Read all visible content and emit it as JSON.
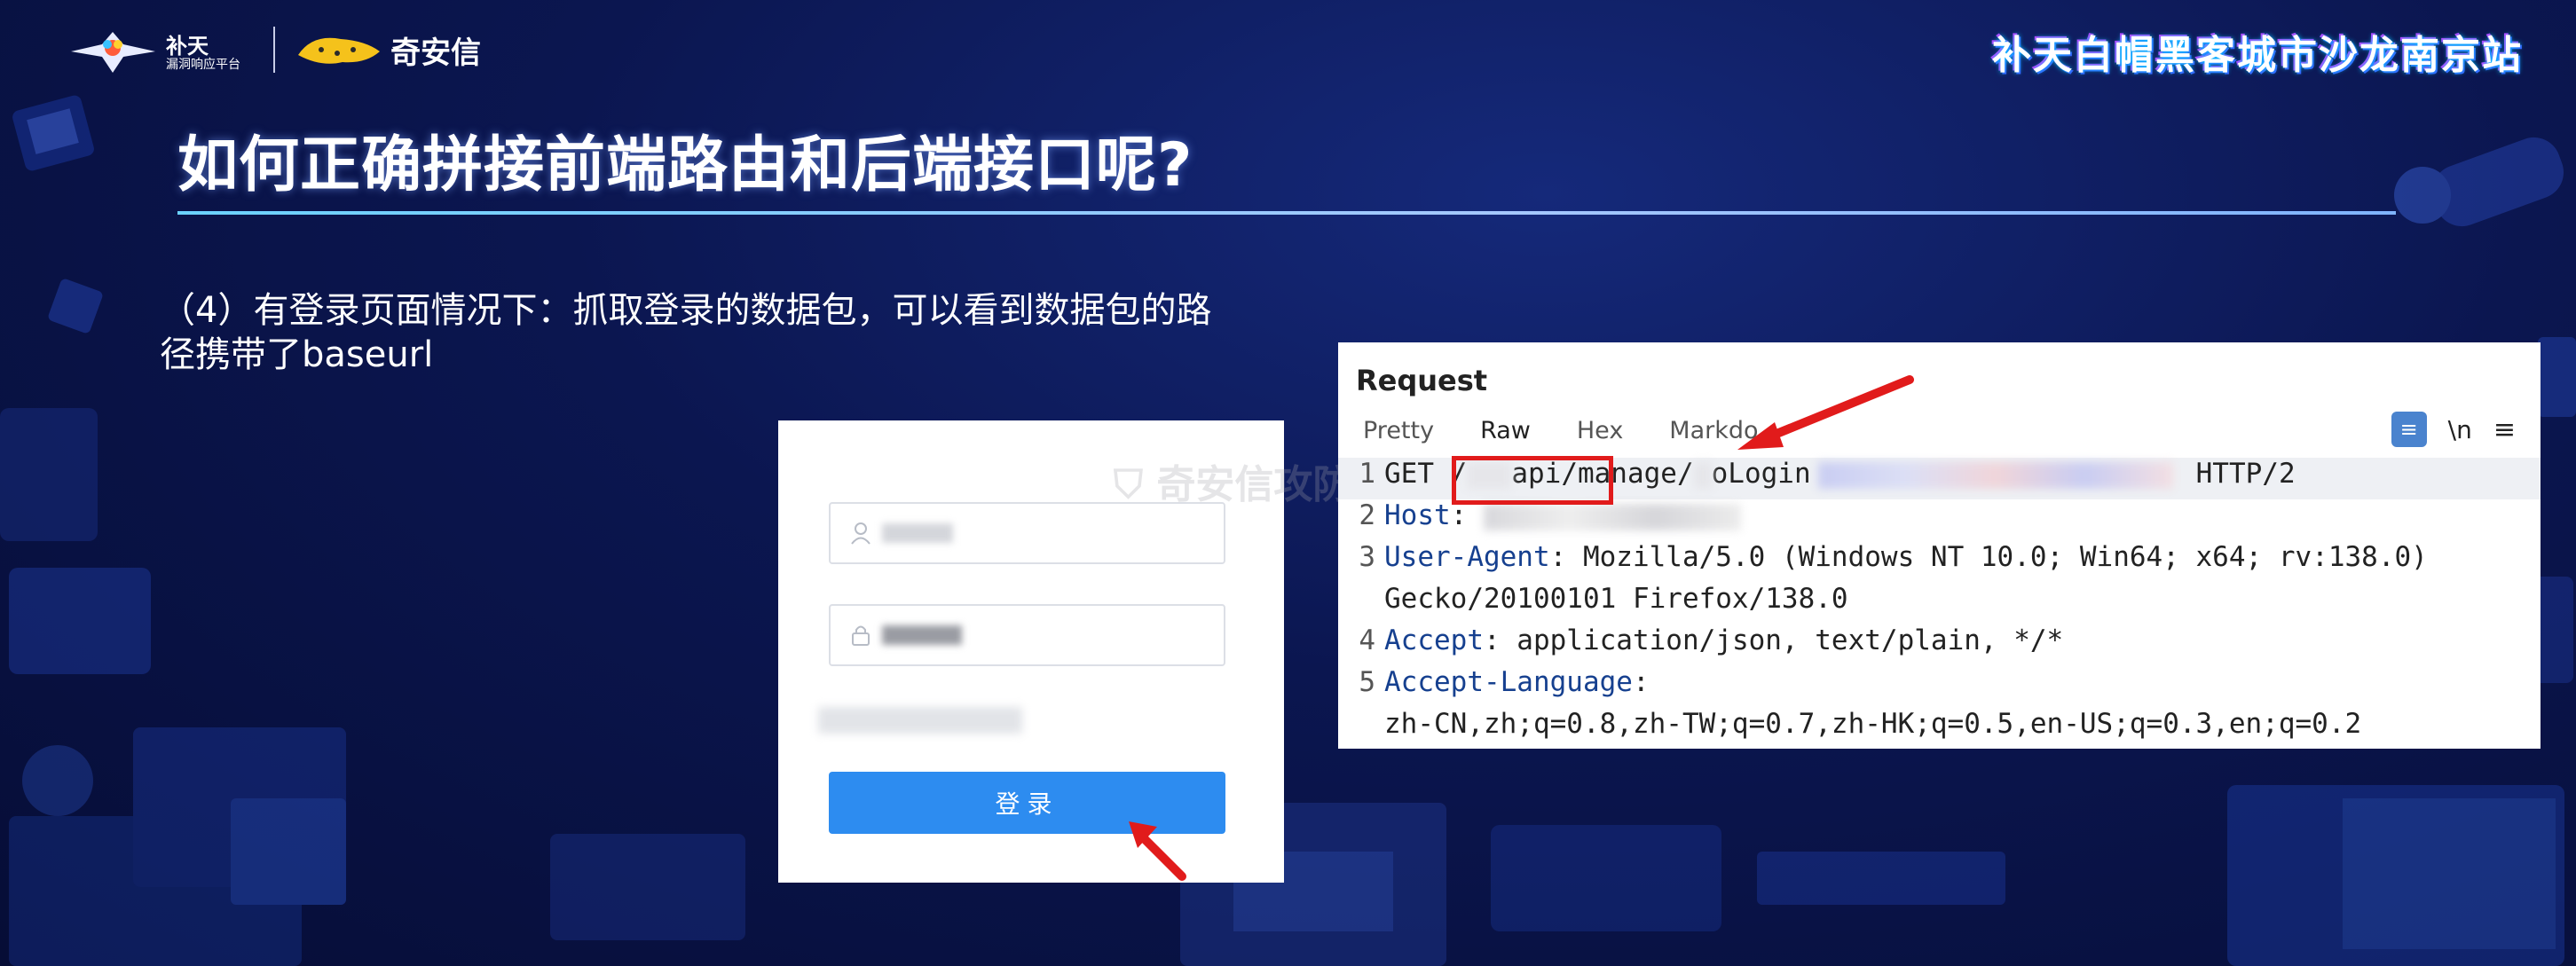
{
  "header": {
    "butian_name": "补天",
    "butian_sub": "漏洞响应平台",
    "qax_name": "奇安信",
    "event_title": "补天白帽黑客城市沙龙南京站"
  },
  "slide": {
    "title": "如何正确拼接前端路由和后端接口呢?",
    "description": "（4）有登录页面情况下：抓取登录的数据包，可以看到数据包的路径携带了baseurl"
  },
  "login": {
    "username_icon": "user-icon",
    "password_icon": "lock-icon",
    "login_button": "登录"
  },
  "watermark": "奇安信攻防社区",
  "request": {
    "title": "Request",
    "tabs": [
      "Pretty",
      "Raw",
      "Hex",
      "Markdo"
    ],
    "active_tab": "Raw",
    "tool_newline": "\\n",
    "lines": [
      {
        "num": "1",
        "parts": [
          {
            "t": "GET /"
          },
          {
            "blur": true,
            "w": 50,
            "c": "#e6e6ea"
          },
          {
            "t": "api/manage/"
          },
          {
            "blur": true,
            "w": 20,
            "c": "#e6e6ea"
          },
          {
            "t": "oLogin"
          }
        ]
      },
      {
        "num": "2",
        "parts": [
          {
            "k": "Host"
          },
          {
            "t": ": "
          }
        ]
      },
      {
        "num": "3",
        "parts": [
          {
            "k": "User-Agent"
          },
          {
            "t": ": Mozilla/5.0 (Windows NT 10.0; Win64; x64; rv:138.0)"
          }
        ]
      },
      {
        "num": "",
        "parts": [
          {
            "t": "Gecko/20100101 Firefox/138.0"
          }
        ]
      },
      {
        "num": "4",
        "parts": [
          {
            "k": "Accept"
          },
          {
            "t": ": application/json, text/plain, */*"
          }
        ]
      },
      {
        "num": "5",
        "parts": [
          {
            "k": "Accept-Language"
          },
          {
            "t": ":"
          }
        ]
      },
      {
        "num": "",
        "parts": [
          {
            "t": "zh-CN,zh;q=0.8,zh-TW;q=0.7,zh-HK;q=0.5,en-US;q=0.3,en;q=0.2"
          }
        ]
      }
    ],
    "line1_suffix": "HTTP/2"
  },
  "colors": {
    "accent_red": "#e11b1b",
    "header_key": "#16408f",
    "login_button": "#2d8cf0"
  }
}
